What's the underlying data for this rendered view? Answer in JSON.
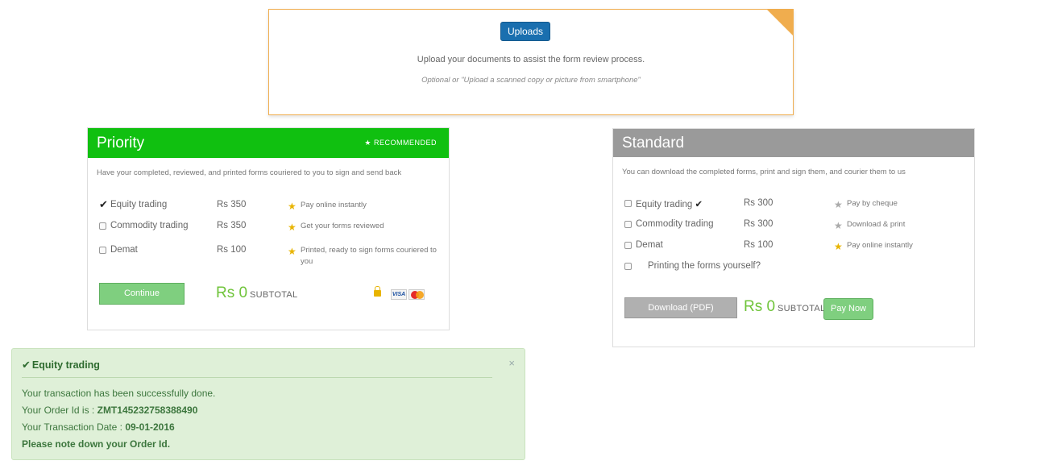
{
  "upload": {
    "button_label": "Uploads",
    "description": "Upload your documents to assist the form review process.",
    "note": "Optional or \"Upload a scanned copy or picture from smartphone\""
  },
  "priority": {
    "title": "Priority",
    "badge": "★ RECOMMENDED",
    "description": "Have your completed, reviewed, and printed forms couriered to you to sign and send back",
    "items": [
      {
        "label": "Equity trading",
        "price": "Rs 350",
        "checked": true,
        "feature": "Pay online instantly"
      },
      {
        "label": "Commodity trading",
        "price": "Rs 350",
        "checked": false,
        "feature": "Get your forms reviewed"
      },
      {
        "label": "Demat",
        "price": "Rs 100",
        "checked": false,
        "feature": "Printed, ready to sign forms couriered to you"
      }
    ],
    "continue_label": "Continue",
    "subtotal_amount": "Rs 0",
    "subtotal_label": "SUBTOTAL",
    "card_labels": {
      "visa": "VISA"
    }
  },
  "standard": {
    "title": "Standard",
    "description": "You can download the completed forms, print and sign them, and courier them to us",
    "items": [
      {
        "label": "Equity trading",
        "price": "Rs 300",
        "feature": "Pay by cheque",
        "star": "grey"
      },
      {
        "label": "Commodity trading",
        "price": "Rs 300",
        "feature": "Download & print",
        "star": "grey"
      },
      {
        "label": "Demat",
        "price": "Rs 100",
        "feature": "Pay online instantly",
        "star": "gold"
      }
    ],
    "print_option": "Printing the forms yourself?",
    "download_label": "Download (PDF)",
    "subtotal_amount": "Rs 0",
    "subtotal_label": "SUBTOTAL",
    "pay_label": "Pay Now"
  },
  "alert": {
    "title": "Equity trading",
    "close": "×",
    "line1": "Your transaction has been successfully done.",
    "order_label": "Your Order Id is :",
    "order_id": "ZMT145232758388490",
    "date_label": "Your Transaction Date :",
    "date": "09-01-2016",
    "note": "Please note down your Order Id."
  },
  "colors": {
    "priority_header": "#10c010",
    "standard_header": "#9a9a9a",
    "upload_border": "#f0ad4e",
    "upload_button": "#1a6faf",
    "subtotal": "#6fc43a",
    "alert_bg": "#dff0d8"
  }
}
